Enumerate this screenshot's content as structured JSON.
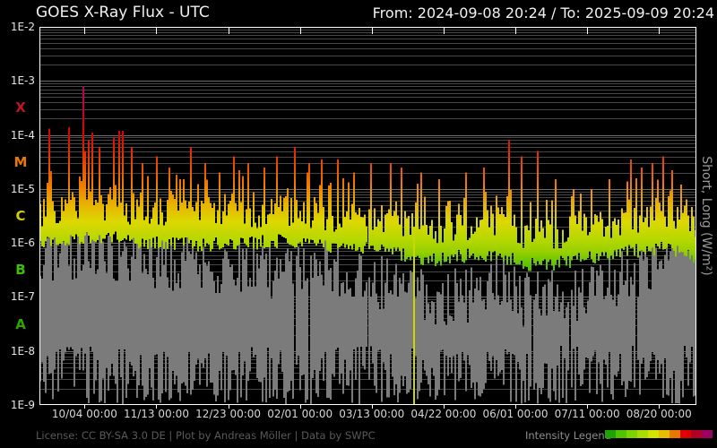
{
  "header": {
    "title": "GOES X-Ray Flux - UTC",
    "range": "From: 2024-09-08 20:24  /  To: 2025-09-09 20:24"
  },
  "footer": {
    "license": "License: CC BY-SA 3.0 DE | Plot by Andreas Möller | Data by SWPC",
    "legend_label": "Intensity Legend",
    "legend_colors": [
      "#1ca400",
      "#50c400",
      "#7cd400",
      "#aade00",
      "#d2e400",
      "#e8bc00",
      "#e87800",
      "#e00000",
      "#b00024",
      "#9c0060"
    ]
  },
  "chart_data": {
    "type": "area",
    "title": "GOES X-Ray Flux - UTC",
    "ylabel_right": "Short, Long (W/m²)",
    "x_start": "2024-09-08 20:24",
    "x_end": "2025-09-09 20:24",
    "x_range_days": 366,
    "y_scale": "log",
    "ylim": [
      1e-09,
      0.01
    ],
    "grid": "log-minor-and-major",
    "y_ticks": [
      {
        "label": "1E-2",
        "exp": -2
      },
      {
        "label": "1E-3",
        "exp": -3
      },
      {
        "label": "1E-4",
        "exp": -4
      },
      {
        "label": "1E-5",
        "exp": -5
      },
      {
        "label": "1E-6",
        "exp": -6
      },
      {
        "label": "1E-7",
        "exp": -7
      },
      {
        "label": "1E-8",
        "exp": -8
      },
      {
        "label": "1E-9",
        "exp": -9
      }
    ],
    "x_ticks": [
      {
        "label": "10/04 00:00",
        "day": 25.15
      },
      {
        "label": "11/13 00:00",
        "day": 65.15
      },
      {
        "label": "12/23 00:00",
        "day": 105.15
      },
      {
        "label": "02/01 00:00",
        "day": 145.15
      },
      {
        "label": "03/13 00:00",
        "day": 185.15
      },
      {
        "label": "04/22 00:00",
        "day": 225.15
      },
      {
        "label": "06/01 00:00",
        "day": 265.15
      },
      {
        "label": "07/11 00:00",
        "day": 305.15
      },
      {
        "label": "08/20 00:00",
        "day": 345.15
      }
    ],
    "flare_classes": [
      {
        "label": "X",
        "color": "#c01428",
        "mid_exp": -3.5
      },
      {
        "label": "M",
        "color": "#e87800",
        "mid_exp": -4.5
      },
      {
        "label": "C",
        "color": "#d2cc00",
        "mid_exp": -5.5
      },
      {
        "label": "B",
        "color": "#3cc000",
        "mid_exp": -6.5
      },
      {
        "label": "A",
        "color": "#2ea400",
        "mid_exp": -7.5
      }
    ],
    "color_scale": [
      {
        "flux": 0.01,
        "color": "#c00070"
      },
      {
        "flux": 0.001,
        "color": "#b8005c"
      },
      {
        "flux": 0.0003,
        "color": "#c40032"
      },
      {
        "flux": 0.0001,
        "color": "#e00000"
      },
      {
        "flux": 3e-05,
        "color": "#e84600"
      },
      {
        "flux": 1e-05,
        "color": "#f08600"
      },
      {
        "flux": 5e-06,
        "color": "#e8b400"
      },
      {
        "flux": 2.5e-06,
        "color": "#dcd800"
      },
      {
        "flux": 1.2e-06,
        "color": "#b8d800"
      },
      {
        "flux": 7e-07,
        "color": "#98d000"
      },
      {
        "flux": 4e-07,
        "color": "#5cc400"
      },
      {
        "flux": 1.5e-07,
        "color": "#38b000"
      },
      {
        "flux": 1e-07,
        "color": "#2ca400"
      },
      {
        "flux": 1e-09,
        "color": "#28a000"
      }
    ],
    "series": {
      "short": {
        "name": "Short",
        "color": "#7b7b7b",
        "envelope_days": [
          0,
          30,
          60,
          90,
          120,
          150,
          170,
          190,
          210,
          225,
          240,
          255,
          270,
          285,
          300,
          315,
          330,
          345,
          355,
          366
        ],
        "envelope_hi": [
          6e-07,
          8e-07,
          5e-07,
          4e-07,
          3e-07,
          4e-07,
          2.5e-07,
          2e-07,
          1.2e-07,
          1e-07,
          1.2e-07,
          2.5e-07,
          8e-08,
          1e-07,
          1.2e-07,
          2e-07,
          3e-07,
          6e-07,
          1e-06,
          5e-07
        ],
        "lo_range": [
          1e-09,
          2e-08
        ]
      },
      "long": {
        "name": "Long",
        "envelope_days": [
          0,
          15,
          30,
          45,
          60,
          75,
          90,
          105,
          120,
          135,
          150,
          165,
          180,
          195,
          210,
          225,
          240,
          255,
          270,
          285,
          300,
          315,
          330,
          345,
          355,
          366
        ],
        "envelope_lo": [
          9e-07,
          1.2e-06,
          1.3e-06,
          1.2e-06,
          1e-06,
          1e-06,
          9e-07,
          1e-06,
          1e-06,
          1.1e-06,
          1e-06,
          8e-07,
          8e-07,
          7e-07,
          5e-07,
          5e-07,
          6e-07,
          6e-07,
          4e-07,
          4e-07,
          5e-07,
          6e-07,
          7e-07,
          8e-07,
          7e-07,
          5e-07
        ],
        "envelope_hi": [
          3e-06,
          5e-06,
          5e-06,
          4e-06,
          4e-06,
          3.5e-06,
          3.5e-06,
          4e-06,
          3.5e-06,
          4e-06,
          3.5e-06,
          3e-06,
          3e-06,
          2.5e-06,
          2e-06,
          1.8e-06,
          2e-06,
          2.5e-06,
          1.5e-06,
          1.4e-06,
          1.8e-06,
          2.2e-06,
          2.5e-06,
          3e-06,
          2.5e-06,
          1.8e-06
        ],
        "flares": [
          [
            5,
            0.00013
          ],
          [
            16,
            0.00014
          ],
          [
            24,
            0.00077
          ],
          [
            25,
            5e-05
          ],
          [
            27,
            8e-05
          ],
          [
            29,
            0.00011
          ],
          [
            33,
            6e-05
          ],
          [
            41,
            9e-05
          ],
          [
            44,
            0.00012
          ],
          [
            46,
            0.00012
          ],
          [
            51,
            6e-05
          ],
          [
            57,
            3e-05
          ],
          [
            65,
            4e-05
          ],
          [
            72,
            2.5e-05
          ],
          [
            78,
            1.5e-05
          ],
          [
            84,
            6e-05
          ],
          [
            92,
            3e-05
          ],
          [
            100,
            2e-05
          ],
          [
            108,
            4e-05
          ],
          [
            116,
            3e-05
          ],
          [
            125,
            2.5e-05
          ],
          [
            132,
            4e-05
          ],
          [
            142,
            6e-05
          ],
          [
            150,
            3e-05
          ],
          [
            157,
            3.5e-05
          ],
          [
            166,
            3.5e-05
          ],
          [
            175,
            2e-05
          ],
          [
            184,
            3e-05
          ],
          [
            195,
            3e-05
          ],
          [
            201,
            2.5e-05
          ],
          [
            212,
            2e-05
          ],
          [
            222,
            1.5e-05
          ],
          [
            237,
            2e-05
          ],
          [
            247,
            2.5e-05
          ],
          [
            261,
            8e-05
          ],
          [
            268,
            4e-05
          ],
          [
            277,
            5e-05
          ],
          [
            287,
            1.5e-05
          ],
          [
            297,
            1e-05
          ],
          [
            307,
            1e-05
          ],
          [
            317,
            1.5e-05
          ],
          [
            329,
            3.5e-05
          ],
          [
            335,
            2.5e-05
          ],
          [
            341,
            3e-05
          ],
          [
            347,
            4e-05
          ],
          [
            352,
            2.2e-05
          ],
          [
            357,
            1.2e-05
          ]
        ],
        "data_gap": {
          "day": 208,
          "from": 2e-06,
          "to": 1e-09,
          "color": "#c8d800"
        }
      }
    }
  }
}
